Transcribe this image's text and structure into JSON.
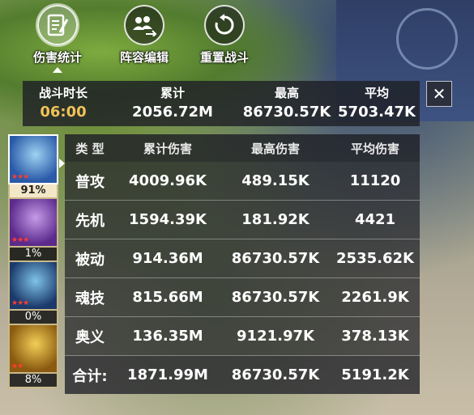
{
  "toolbar": {
    "items": [
      {
        "label": "伤害统计",
        "icon": "clipboard-pen-icon",
        "active": true
      },
      {
        "label": "阵容编辑",
        "icon": "team-edit-icon",
        "active": false
      },
      {
        "label": "重置战斗",
        "icon": "reset-icon",
        "active": false
      }
    ]
  },
  "summary": {
    "duration_label": "战斗时长",
    "duration_value": "06:00",
    "total_label": "累计",
    "total_value": "2056.72M",
    "max_label": "最高",
    "max_value": "86730.57K",
    "avg_label": "平均",
    "avg_value": "5703.47K",
    "close_symbol": "✕"
  },
  "heroes": [
    {
      "percent": "91%",
      "stars": "★★★",
      "colors": [
        "#2a5aa8",
        "#9fd2f2"
      ],
      "selected": true
    },
    {
      "percent": "1%",
      "stars": "★★★",
      "colors": [
        "#5b2a8c",
        "#c59be8"
      ],
      "selected": false
    },
    {
      "percent": "0%",
      "stars": "★★★",
      "colors": [
        "#1b3a6b",
        "#7fc3e8"
      ],
      "selected": false
    },
    {
      "percent": "8%",
      "stars": "★★",
      "colors": [
        "#8a5a10",
        "#f2cf56"
      ],
      "selected": false
    }
  ],
  "table": {
    "headers": [
      "类 型",
      "累计伤害",
      "最高伤害",
      "平均伤害"
    ],
    "rows": [
      [
        "普攻",
        "4009.96K",
        "489.15K",
        "11120"
      ],
      [
        "先机",
        "1594.39K",
        "181.92K",
        "4421"
      ],
      [
        "被动",
        "914.36M",
        "86730.57K",
        "2535.62K"
      ],
      [
        "魂技",
        "815.66M",
        "86730.57K",
        "2261.9K"
      ],
      [
        "奥义",
        "136.35M",
        "9121.97K",
        "378.13K"
      ],
      [
        "合计:",
        "1871.99M",
        "86730.57K",
        "5191.2K"
      ]
    ]
  },
  "colors": {
    "accent_gold": "#f0c25a",
    "panel": "#1e2026"
  }
}
